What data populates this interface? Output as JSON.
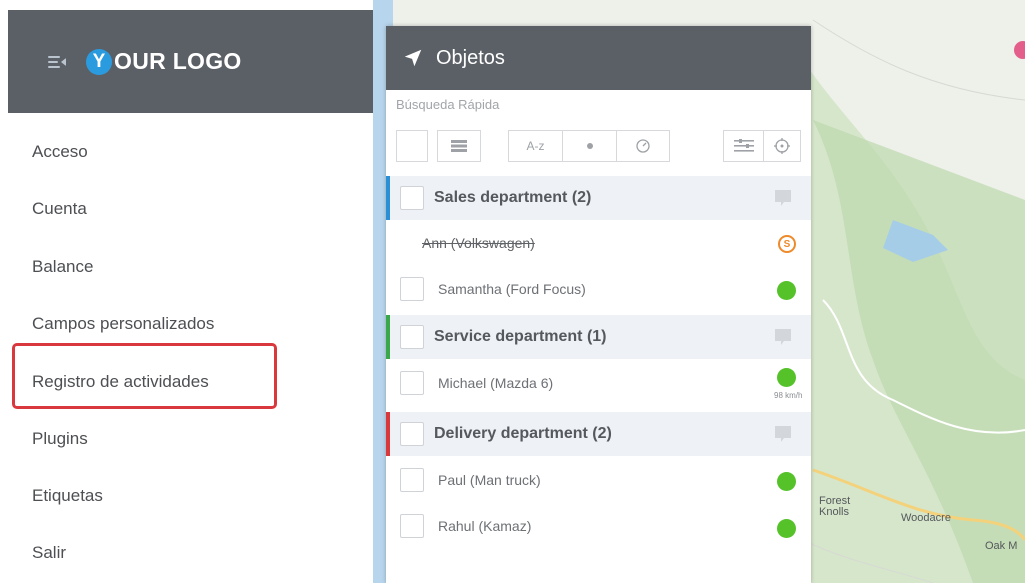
{
  "brand": {
    "logo_letter": "Y",
    "logo_text": "OUR LOGO"
  },
  "menu": {
    "items": [
      "Acceso",
      "Cuenta",
      "Balance",
      "Campos personalizados",
      "Registro de actividades",
      "Plugins",
      "Etiquetas",
      "Salir"
    ],
    "highlighted_index": 4,
    "highlight_color": "#d9383c"
  },
  "panel": {
    "title": "Objetos",
    "search_placeholder": "Búsqueda Rápida",
    "toolbar": {
      "sort_az_label": "A-z"
    },
    "groups": [
      {
        "name": "Sales department (2)",
        "color": "#2b8fd6",
        "items": [
          {
            "name": "Ann (Volkswagen)",
            "status": "stopped",
            "status_text": "S",
            "struck": true
          },
          {
            "name": "Samantha (Ford Focus)",
            "status": "online"
          }
        ]
      },
      {
        "name": "Service department (1)",
        "color": "#3aa84a",
        "items": [
          {
            "name": "Michael (Mazda 6)",
            "status": "moving",
            "speed": "98 km/h"
          }
        ]
      },
      {
        "name": "Delivery department (2)",
        "color": "#d9383c",
        "items": [
          {
            "name": "Paul (Man truck)",
            "status": "online"
          },
          {
            "name": "Rahul (Kamaz)",
            "status": "online"
          }
        ]
      }
    ]
  },
  "map": {
    "labels": {
      "forest_knolls": "Forest\nKnolls",
      "woodacre": "Woodacre",
      "oak": "Oak M"
    }
  },
  "colors": {
    "header_bg": "#5b6067",
    "online": "#56c22a",
    "stopped": "#ef8a2a"
  }
}
